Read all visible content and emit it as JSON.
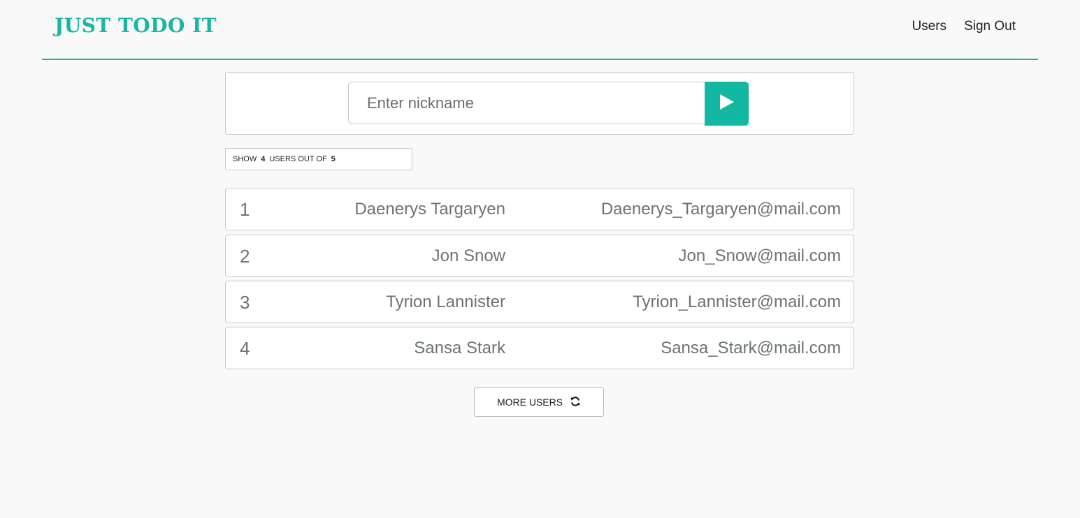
{
  "header": {
    "logo": "JUST TODO IT",
    "nav": {
      "users": "Users",
      "sign_out": "Sign Out"
    },
    "accent_color": "#1ab5a3"
  },
  "search": {
    "placeholder": "Enter nickname",
    "value": "",
    "submit_icon": "play-icon"
  },
  "counter": {
    "prefix": "SHOW",
    "shown": "4",
    "middle": "USERS OUT OF",
    "total": "5"
  },
  "users": [
    {
      "index": "1",
      "name": "Daenerys Targaryen",
      "email": "Daenerys_Targaryen@mail.com"
    },
    {
      "index": "2",
      "name": "Jon Snow",
      "email": "Jon_Snow@mail.com"
    },
    {
      "index": "3",
      "name": "Tyrion Lannister",
      "email": "Tyrion_Lannister@mail.com"
    },
    {
      "index": "4",
      "name": "Sansa Stark",
      "email": "Sansa_Stark@mail.com"
    }
  ],
  "more_button": {
    "label": "MORE USERS",
    "icon": "refresh-icon"
  }
}
